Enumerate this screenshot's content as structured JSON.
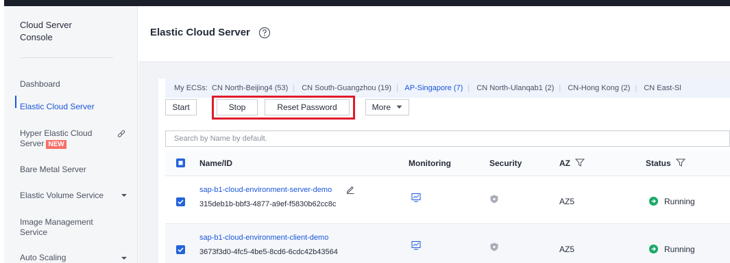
{
  "sidebar": {
    "console_title": "Cloud Server Console",
    "items": [
      {
        "label": "Dashboard"
      },
      {
        "label": "Elastic Cloud Server"
      },
      {
        "label": "Hyper Elastic Cloud Server",
        "badge": "NEW"
      },
      {
        "label": "Bare Metal Server"
      },
      {
        "label": "Elastic Volume Service"
      },
      {
        "label": "Image Management Service"
      },
      {
        "label": "Auto Scaling"
      }
    ]
  },
  "header": {
    "title": "Elastic Cloud Server"
  },
  "regions": {
    "prefix": "My ECSs:",
    "items": [
      {
        "label": "CN North-Beijing4 (53)"
      },
      {
        "label": "CN South-Guangzhou (19)"
      },
      {
        "label": "AP-Singapore (7)"
      },
      {
        "label": "CN North-Ulanqab1 (2)"
      },
      {
        "label": "CN-Hong Kong (2)"
      },
      {
        "label": "CN East-Sl"
      }
    ],
    "active_index": 2
  },
  "toolbar": {
    "start": "Start",
    "stop": "Stop",
    "reset_password": "Reset Password",
    "more": "More"
  },
  "search": {
    "placeholder": "Search by Name by default."
  },
  "table": {
    "headers": {
      "name": "Name/ID",
      "monitoring": "Monitoring",
      "security": "Security",
      "az": "AZ",
      "status": "Status"
    },
    "rows": [
      {
        "name": "sap-b1-cloud-environment-server-demo",
        "id": "315deb1b-bbf3-4877-a9ef-f5830b62cc8c",
        "az": "AZ5",
        "status": "Running"
      },
      {
        "name": "sap-b1-cloud-environment-client-demo",
        "id": "3673f3d0-4fc5-4be5-8cd6-6cdc42b43564",
        "az": "AZ5",
        "status": "Running"
      }
    ]
  },
  "colors": {
    "accent": "#1a56d9",
    "highlight": "#e01b2a",
    "running": "#1aa867",
    "new_badge": "#f66f6a"
  }
}
